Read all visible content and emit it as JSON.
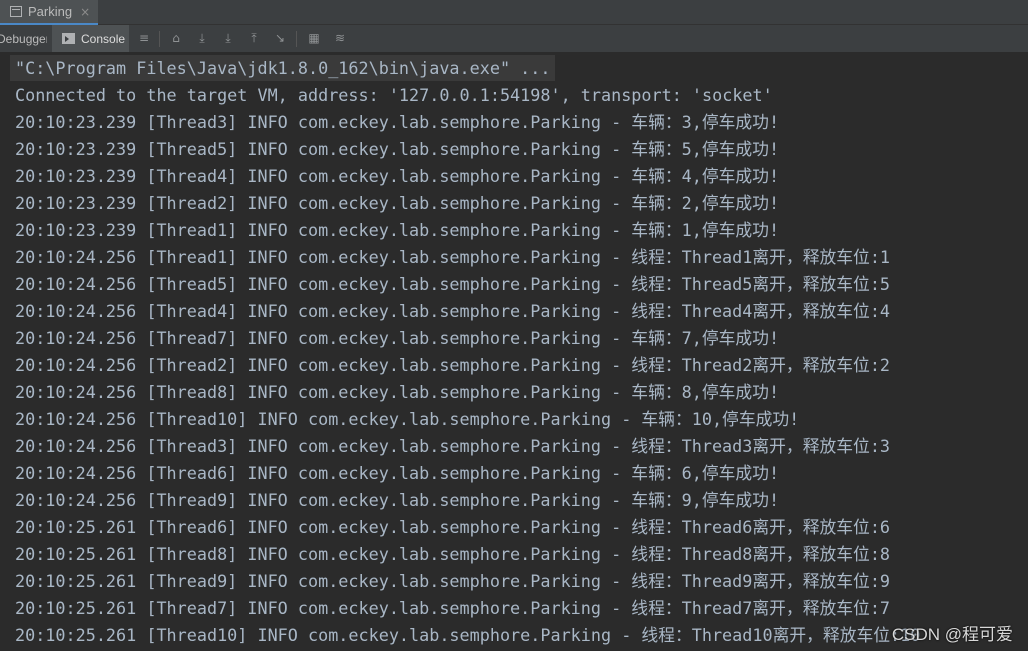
{
  "run_tab": {
    "title": "Parking",
    "icon": "window-icon",
    "close": "×"
  },
  "toolbar": {
    "debugger_label": "Debugger",
    "console_label": "Console",
    "icons": [
      "menu-icon",
      "restore-layout-icon",
      "step-over-icon",
      "step-into-icon",
      "force-step-into-icon",
      "step-out-icon",
      "run-to-cursor-icon",
      "evaluate-expression-icon",
      "trace-icon"
    ]
  },
  "console": {
    "command": "\"C:\\Program Files\\Java\\jdk1.8.0_162\\bin\\java.exe\" ...",
    "connected": "Connected to the target VM, address: '127.0.0.1:54198', transport: 'socket'",
    "lines": [
      "20:10:23.239 [Thread3] INFO com.eckey.lab.semphore.Parking - 车辆：3,停车成功!",
      "20:10:23.239 [Thread5] INFO com.eckey.lab.semphore.Parking - 车辆：5,停车成功!",
      "20:10:23.239 [Thread4] INFO com.eckey.lab.semphore.Parking - 车辆：4,停车成功!",
      "20:10:23.239 [Thread2] INFO com.eckey.lab.semphore.Parking - 车辆：2,停车成功!",
      "20:10:23.239 [Thread1] INFO com.eckey.lab.semphore.Parking - 车辆：1,停车成功!",
      "20:10:24.256 [Thread1] INFO com.eckey.lab.semphore.Parking - 线程：Thread1离开，释放车位:1",
      "20:10:24.256 [Thread5] INFO com.eckey.lab.semphore.Parking - 线程：Thread5离开，释放车位:5",
      "20:10:24.256 [Thread4] INFO com.eckey.lab.semphore.Parking - 线程：Thread4离开，释放车位:4",
      "20:10:24.256 [Thread7] INFO com.eckey.lab.semphore.Parking - 车辆：7,停车成功!",
      "20:10:24.256 [Thread2] INFO com.eckey.lab.semphore.Parking - 线程：Thread2离开，释放车位:2",
      "20:10:24.256 [Thread8] INFO com.eckey.lab.semphore.Parking - 车辆：8,停车成功!",
      "20:10:24.256 [Thread10] INFO com.eckey.lab.semphore.Parking - 车辆：10,停车成功!",
      "20:10:24.256 [Thread3] INFO com.eckey.lab.semphore.Parking - 线程：Thread3离开，释放车位:3",
      "20:10:24.256 [Thread6] INFO com.eckey.lab.semphore.Parking - 车辆：6,停车成功!",
      "20:10:24.256 [Thread9] INFO com.eckey.lab.semphore.Parking - 车辆：9,停车成功!",
      "20:10:25.261 [Thread6] INFO com.eckey.lab.semphore.Parking - 线程：Thread6离开，释放车位:6",
      "20:10:25.261 [Thread8] INFO com.eckey.lab.semphore.Parking - 线程：Thread8离开，释放车位:8",
      "20:10:25.261 [Thread9] INFO com.eckey.lab.semphore.Parking - 线程：Thread9离开，释放车位:9",
      "20:10:25.261 [Thread7] INFO com.eckey.lab.semphore.Parking - 线程：Thread7离开，释放车位:7",
      "20:10:25.261 [Thread10] INFO com.eckey.lab.semphore.Parking - 线程：Thread10离开，释放车位:10"
    ]
  },
  "watermark": "CSDN @程可爱",
  "colors": {
    "background": "#2b2b2b",
    "text": "#a9b7c6",
    "toolbar": "#3c3f41",
    "accent": "#4a88c7"
  }
}
